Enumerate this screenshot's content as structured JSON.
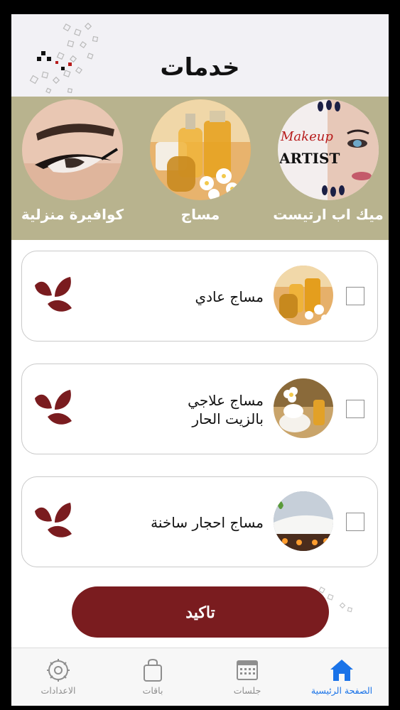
{
  "header": {
    "title": "خدمات"
  },
  "categories": [
    {
      "label": "ميك اب ارتيست",
      "image": "makeup-artist-photo"
    },
    {
      "label": "مساج",
      "image": "massage-oils-photo"
    },
    {
      "label": "كوافيرة منزلية",
      "image": "eye-makeup-photo"
    }
  ],
  "services": [
    {
      "name": "مساج عادي",
      "checked": false,
      "image": "massage-oils-photo"
    },
    {
      "name": "مساج علاجي بالزيت الحار",
      "checked": false,
      "image": "hot-oil-spa-photo"
    },
    {
      "name": "مساج احجار ساخنة",
      "checked": false,
      "image": "hot-stones-spa-photo"
    }
  ],
  "confirm": {
    "label": "تاكيد"
  },
  "tabbar": [
    {
      "label": "الصفحة الرئيسية",
      "icon": "home-icon",
      "active": true
    },
    {
      "label": "جلسات",
      "icon": "calendar-icon",
      "active": false
    },
    {
      "label": "باقات",
      "icon": "bag-icon",
      "active": false
    },
    {
      "label": "الاعدادات",
      "icon": "gear-icon",
      "active": false
    }
  ],
  "colors": {
    "accent": "#7a1c1f",
    "category_band": "#b8b38e",
    "header_bg": "#f2f1f5",
    "tab_active": "#1a73e8",
    "tab_inactive": "#8e8e8e"
  }
}
